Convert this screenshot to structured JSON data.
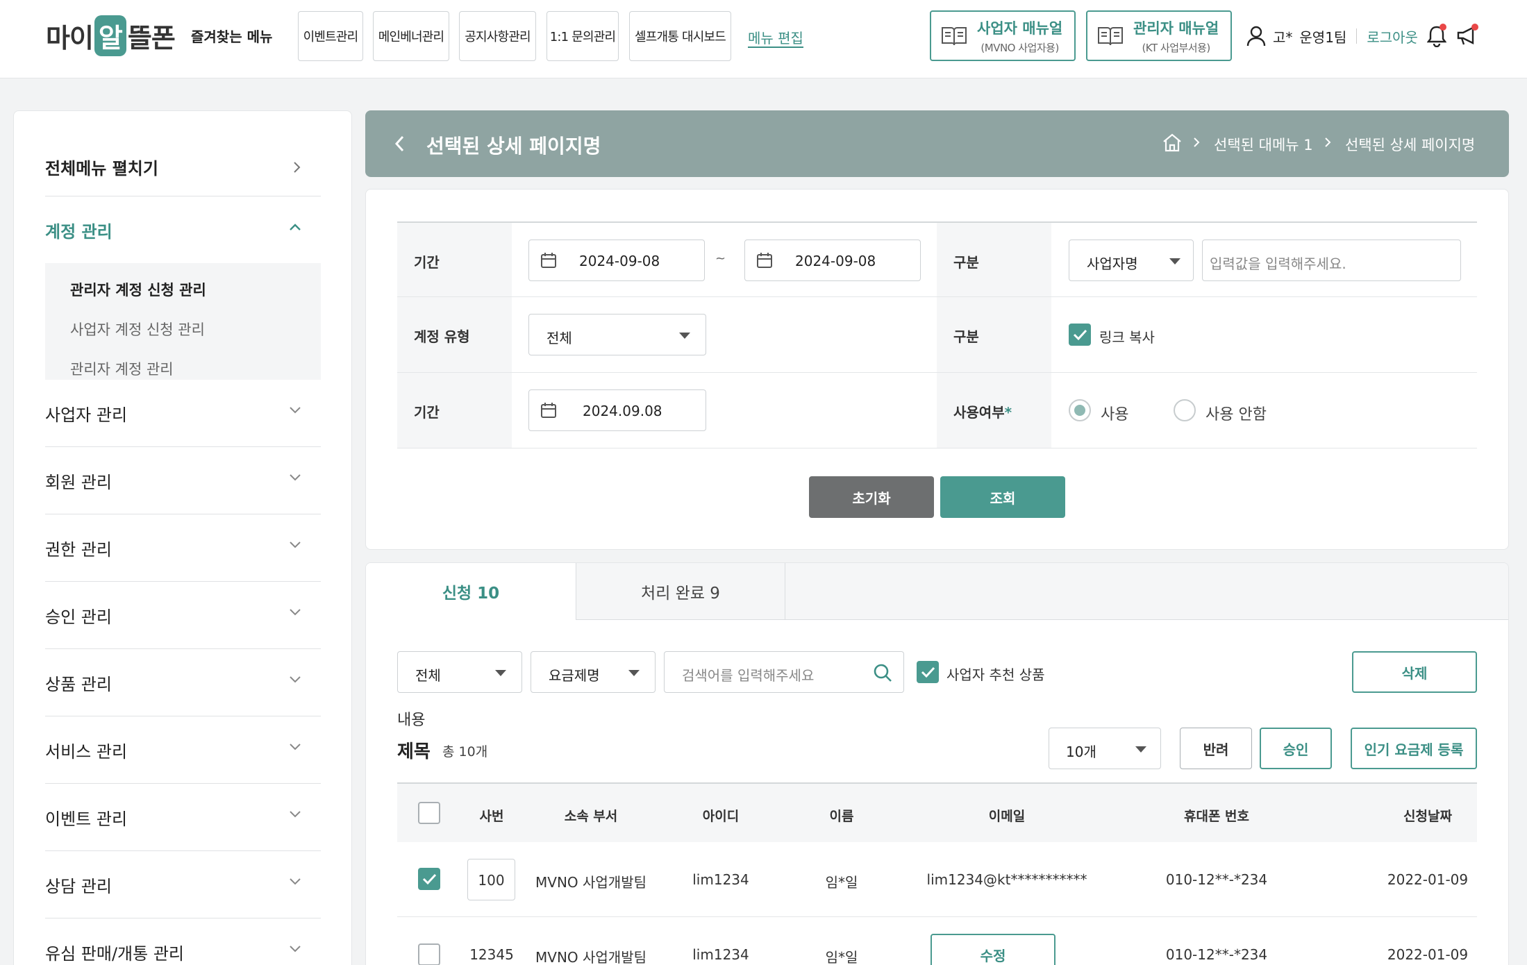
{
  "header": {
    "logo": "마이알뜰폰",
    "favorites_title": "즐겨찾는 메뉴",
    "favorites": [
      "이벤트관리",
      "메인베너관리",
      "공지사항관리",
      "1:1 문의관리",
      "셀프개통 대시보드"
    ],
    "menu_edit": "메뉴 편집",
    "manual_business": {
      "title": "사업자 매뉴얼",
      "sub": "(MVNO 사업자용)"
    },
    "manual_admin": {
      "title": "관리자 매뉴얼",
      "sub": "(KT 사업부서용)"
    },
    "user_name": "고*",
    "user_team": "운영1팀",
    "logout": "로그아웃",
    "icons": [
      "user-icon",
      "bell-icon",
      "megaphone-icon"
    ],
    "accent_color": "#4a9a90"
  },
  "sidebar": {
    "expand_all": "전체메뉴 펼치기",
    "open_section": "계정 관리",
    "sub_items": [
      "관리자 계정 신청 관리",
      "사업자 계정 신청 관리",
      "관리자 계정 관리"
    ],
    "sections": [
      "사업자 관리",
      "회원 관리",
      "권한 관리",
      "승인 관리",
      "상품 관리",
      "서비스 관리",
      "이벤트 관리",
      "상담 관리",
      "유심 판매/개통 관리"
    ]
  },
  "titlebar": {
    "title": "선택된 상세 페이지명",
    "breadcrumb": [
      "선택된 대메뉴 1",
      "선택된 상세 페이지명"
    ],
    "background": "#8fa4a2"
  },
  "filters": {
    "period_label": "기간",
    "date_from": "2024-09-08",
    "date_sep": "~",
    "date_to": "2024-09-08",
    "category_label": "구분",
    "category_select": "사업자명",
    "category_placeholder": "입력값을 입력해주세요.",
    "account_type_label": "계정 유형",
    "account_type_value": "전체",
    "category2_label": "구분",
    "link_copy_label": "링크 복사",
    "link_copy_checked": true,
    "period2_label": "기간",
    "period2_value": "2024.09.08",
    "usage_label": "사용여부",
    "usage_required_mark": "*",
    "usage_options": [
      "사용",
      "사용 안함"
    ],
    "usage_selected": "사용",
    "reset_button": "초기화",
    "search_button": "조회"
  },
  "list": {
    "tabs": [
      {
        "label": "신청 10"
      },
      {
        "label": "처리 완료 9"
      }
    ],
    "filter_all": "전체",
    "filter_plan": "요금제명",
    "search_placeholder": "검색어를 입력해주세요",
    "recommend_label": "사업자 추천 상품",
    "recommend_checked": true,
    "delete_button": "삭제",
    "content_label": "내용",
    "table_title": "제목",
    "total_count": "총 10개",
    "page_size": "10개",
    "reject_button": "반려",
    "approve_button": "승인",
    "popular_button": "인기 요금제 등록",
    "columns": [
      "사번",
      "소속 부서",
      "아이디",
      "이름",
      "이메일",
      "휴대폰 번호",
      "신청날짜"
    ],
    "rows": [
      {
        "checked": true,
        "emp_no": "100",
        "dept": "MVNO 사업개발팀",
        "id": "lim1234",
        "name": "임*일",
        "email": "lim1234@kt***********",
        "phone": "010-12**-*234",
        "date": "2022-01-09"
      },
      {
        "checked": false,
        "emp_no": "12345",
        "dept": "MVNO 사업개발팀",
        "id": "lim1234",
        "name": "임*일",
        "email_button": "수정",
        "phone": "010-12**-*234",
        "date": "2022-01-09"
      }
    ]
  }
}
